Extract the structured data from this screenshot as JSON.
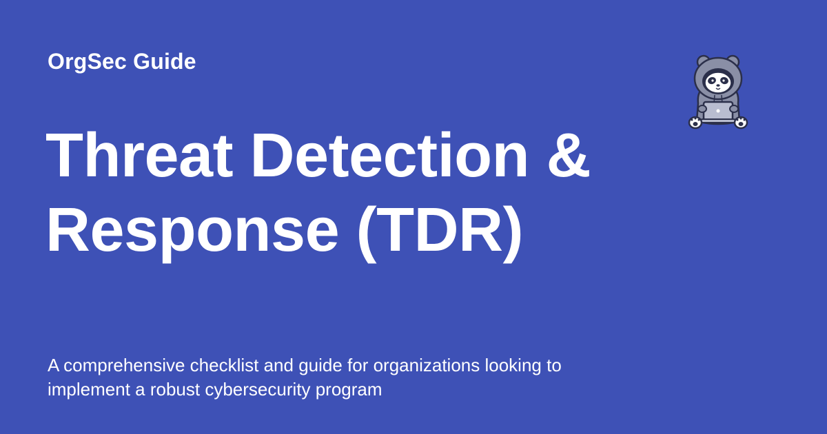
{
  "brand": {
    "name": "OrgSec Guide"
  },
  "hero": {
    "title_line1": "Threat Detection &",
    "title_line2": "Response (TDR)",
    "subtitle_line1": "A comprehensive checklist and guide for organizations looking to",
    "subtitle_line2": "implement a robust cybersecurity program"
  },
  "mascot": {
    "icon": "hooded-panda-laptop-icon"
  },
  "colors": {
    "background": "#3e51b6",
    "text": "#ffffff",
    "mascot_hood": "#8a8fa6",
    "mascot_outline": "#2b2f4a",
    "mascot_laptop": "#b9bdd0"
  }
}
